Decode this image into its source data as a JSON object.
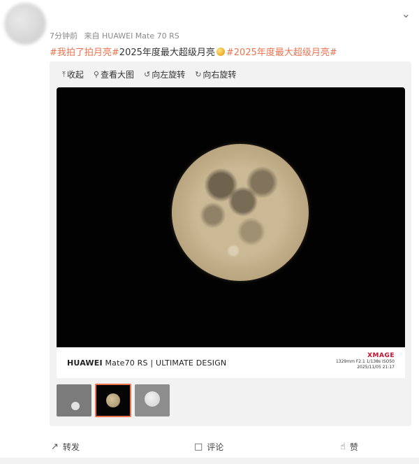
{
  "post": {
    "time": "7分钟前",
    "source": "来自 HUAWEI Mate 70 RS",
    "tag1": "#我拍了拍月亮#",
    "text": "2025年度最大超级月亮",
    "tag2": "#2025年度最大超级月亮#"
  },
  "toolbar": {
    "collapse": "收起",
    "view_large": "查看大图",
    "rotate_left": "向左旋转",
    "rotate_right": "向右旋转"
  },
  "watermark": {
    "brand": "HUAWEI",
    "model_line": "Mate70 RS | ULTIMATE DESIGN",
    "xmage": "XMAGE",
    "exif_line1": "1329mm  F2.1  1/138s  ISO50",
    "exif_line2": "2025/11/05  21:17"
  },
  "actions": {
    "repost": "转发",
    "comment": "评论",
    "like": "赞"
  },
  "icons": {
    "collapse": "arrow-up-icon",
    "view_large": "magnifier-icon",
    "rotate_left": "rotate-left-icon",
    "rotate_right": "rotate-right-icon",
    "repost": "share-icon",
    "comment": "comment-icon",
    "like": "thumbs-up-icon",
    "menu": "chevron-down-icon"
  },
  "colors": {
    "accent": "#eb7350",
    "xmage_red": "#c8102e"
  },
  "thumbnails": {
    "selected_index": 1
  }
}
